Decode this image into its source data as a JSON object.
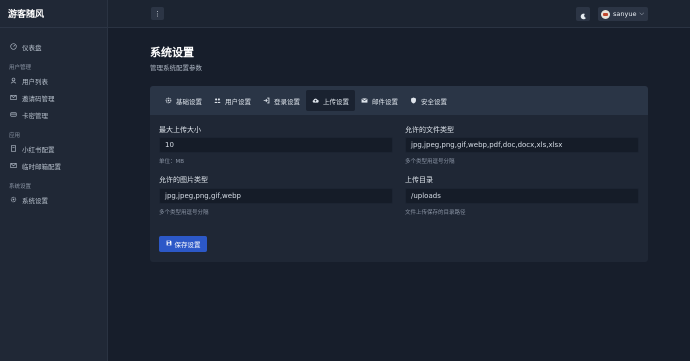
{
  "app": {
    "title": "游客随风"
  },
  "sidebar": {
    "items": [
      {
        "label": "仪表盘",
        "icon": "dashboard-icon"
      },
      {
        "section": "用户管理"
      },
      {
        "label": "用户列表",
        "icon": "users-icon"
      },
      {
        "label": "邀请码管理",
        "icon": "invite-icon"
      },
      {
        "label": "卡密管理",
        "icon": "card-icon"
      },
      {
        "section": "应用"
      },
      {
        "label": "小红书配置",
        "icon": "book-icon"
      },
      {
        "label": "临时邮箱配置",
        "icon": "mail-icon"
      },
      {
        "section": "系统设置"
      },
      {
        "label": "系统设置",
        "icon": "gear-icon"
      }
    ]
  },
  "topbar": {
    "menu_icon": "⋮",
    "user_name": "sanyue"
  },
  "page": {
    "title": "系统设置",
    "subtitle": "管理系统配置参数"
  },
  "tabs": [
    {
      "label": "基础设置",
      "icon": "gear-icon",
      "active": false
    },
    {
      "label": "用户设置",
      "icon": "users-icon",
      "active": false
    },
    {
      "label": "登录设置",
      "icon": "login-icon",
      "active": false
    },
    {
      "label": "上传设置",
      "icon": "upload-icon",
      "active": true
    },
    {
      "label": "邮件设置",
      "icon": "mail-icon",
      "active": false
    },
    {
      "label": "安全设置",
      "icon": "shield-icon",
      "active": false
    }
  ],
  "form": {
    "max_upload": {
      "label": "最大上传大小",
      "value": "10",
      "help": "单位：MB"
    },
    "allowed_files": {
      "label": "允许的文件类型",
      "value": "jpg,jpeg,png,gif,webp,pdf,doc,docx,xls,xlsx",
      "help": "多个类型用逗号分隔"
    },
    "allowed_images": {
      "label": "允许的图片类型",
      "value": "jpg,jpeg,png,gif,webp",
      "help": "多个类型用逗号分隔"
    },
    "upload_dir": {
      "label": "上传目录",
      "value": "/uploads",
      "help": "文件上传保存的目录路径"
    },
    "save_label": "保存设置"
  },
  "colors": {
    "accent": "#2c58c7",
    "background": "#171e2b",
    "sidebar": "#202836"
  }
}
